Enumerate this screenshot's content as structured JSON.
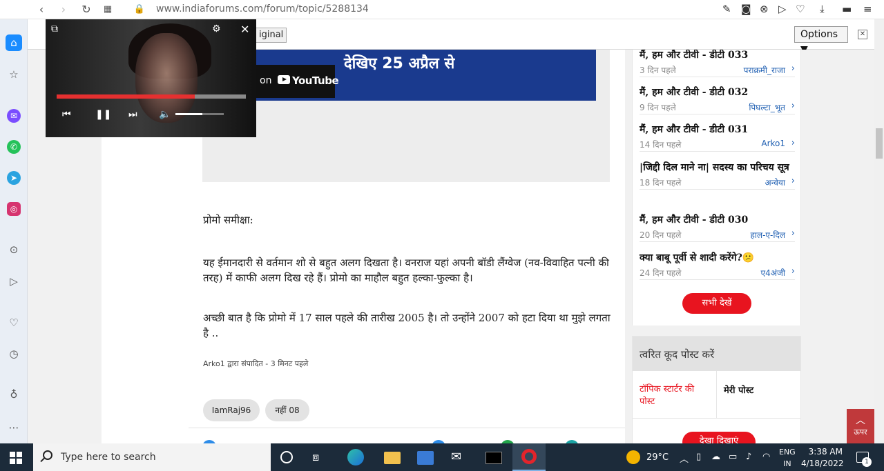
{
  "browser": {
    "url": "www.indiaforums.com/forum/topic/5288134"
  },
  "translate": {
    "original_label": "iginal",
    "options_label": "Options ▼",
    "close_label": "✕"
  },
  "video": {
    "progress": 0.73,
    "volume": 0.55
  },
  "post": {
    "banner_text": "देखिए 25 अप्रैल से",
    "yt_on": "on",
    "yt_brand": "YouTube",
    "paragraphs": [
      "प्रोमो समीक्षा:",
      "यह ईमानदारी से वर्तमान शो से बहुत अलग दिखता है। वनराज यहां अपनी बॉडी लैंग्वेज (नव-विवाहित पत्नी की तरह) में काफी अलग दिख रहे हैं। प्रोमो का माहौल बहुत हल्का-फुल्का है।",
      "अच्छी बात है कि प्रोमो में 17 साल पहले की तारीख 2005 है। तो उन्होंने 2007 को हटा दिया था मुझे लगता है .."
    ],
    "edited": "Arko1 द्वारा संपादित - 3 मिनट पहले",
    "tags": [
      "IamRaj96",
      "नहीं 08"
    ]
  },
  "related": {
    "items": [
      {
        "title": "मैं, हम और टीवी - डीटी 033",
        "time": "3 दिन पहले",
        "author": "पराक्रमी_राजा"
      },
      {
        "title": "मैं, हम और टीवी - डीटी 032",
        "time": "9 दिन पहले",
        "author": "पिघल्टा_भूत"
      },
      {
        "title": "मैं, हम और टीवी - डीटी 031",
        "time": "14 दिन पहले",
        "author": "Arko1"
      },
      {
        "title": "|जिद्दी दिल माने ना| सदस्य का परिचय सूत्र",
        "time": "18 दिन पहले",
        "author": "अन्वेया"
      },
      {
        "title": "मैं, हम और टीवी - डीटी 030",
        "time": "20 दिन पहले",
        "author": "हाल-ए-दिल"
      },
      {
        "title": "क्या बाबू पूर्वी से शादी करेंगे?😕",
        "time": "24 दिन पहले",
        "author": "ए4अंजी"
      }
    ],
    "see_all": "सभी देखें"
  },
  "jump": {
    "title": "त्वरित कूद पोस्ट करें",
    "tab_starter": "टॉपिक स्टार्टर की पोस्ट",
    "tab_mine": "मेरी पोस्ट",
    "show_button": "देखा दिखाएं"
  },
  "upbutton": {
    "label": "ऊपर"
  },
  "taskbar": {
    "search_placeholder": "Type here to search",
    "temperature": "29°C",
    "lang_top": "ENG",
    "lang_bottom": "IN",
    "time": "3:38 AM",
    "date": "4/18/2022",
    "notif_count": "1"
  },
  "colors": {
    "accent_red": "#e8141f",
    "banner_blue": "#1a3a8e",
    "link_blue": "#1f5fb2"
  }
}
